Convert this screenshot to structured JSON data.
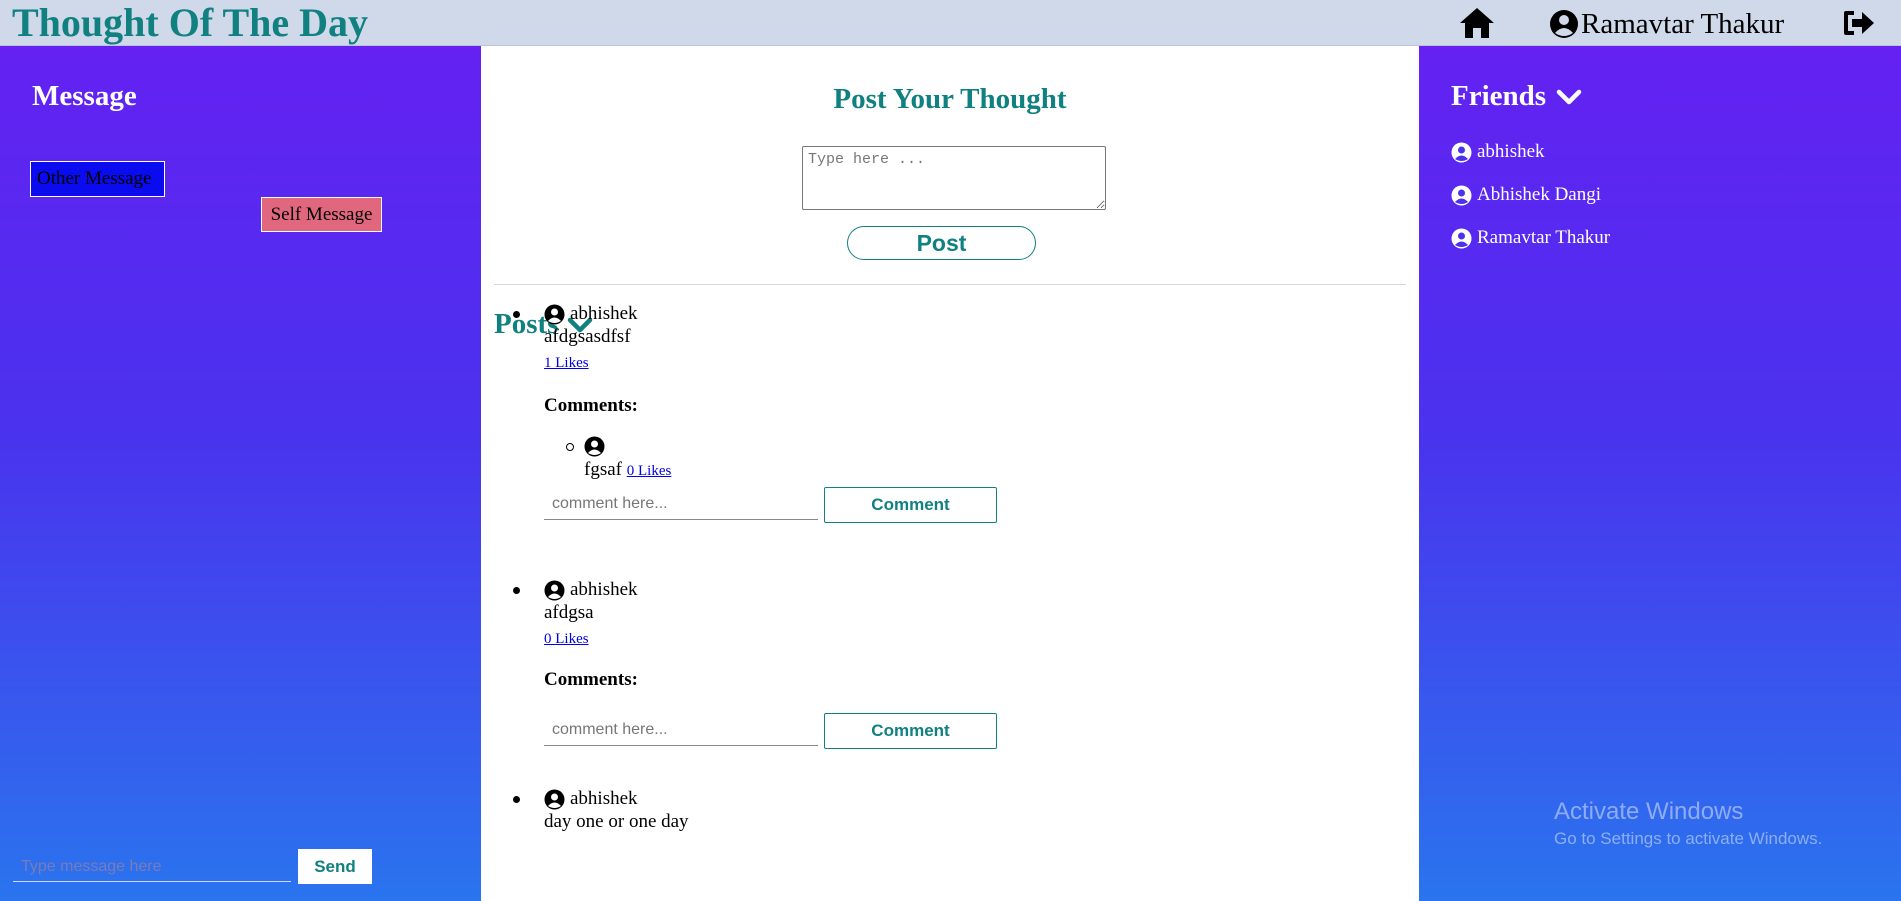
{
  "header": {
    "title": "Thought Of The Day",
    "username": "Ramavtar Thakur",
    "icons": [
      "home-icon",
      "user-circle-icon",
      "logout-icon"
    ]
  },
  "messages": {
    "heading": "Message",
    "other_message": "Other Message",
    "self_message": "Self Message",
    "input_placeholder": "Type message here",
    "send_label": "Send",
    "colors": {
      "other_bg": "#0b0bf0",
      "self_bg": "#e0677e"
    }
  },
  "composer": {
    "heading": "Post Your Thought",
    "textarea_placeholder": "Type here ...",
    "post_label": "Post"
  },
  "posts": {
    "heading": "Posts",
    "comments_label": "Comments:",
    "comment_placeholder": "comment here...",
    "comment_button": "Comment",
    "items": [
      {
        "author": "abhishek",
        "text": "afdgsasdfsf",
        "likes": "1 Likes",
        "comments": [
          {
            "user": "",
            "text": "fgsaf",
            "likes": "0 Likes"
          }
        ]
      },
      {
        "author": "abhishek",
        "text": "afdgsa",
        "likes": "0 Likes",
        "comments": []
      },
      {
        "author": "abhishek",
        "text": "day one or one day"
      }
    ]
  },
  "friends": {
    "heading": "Friends",
    "items": [
      "abhishek",
      "Abhishek Dangi",
      "Ramavtar Thakur"
    ]
  },
  "watermark": {
    "title": "Activate Windows",
    "subtitle": "Go to Settings to activate Windows."
  },
  "theme": {
    "accent": "#118080",
    "topbar_bg": "#cfd9ea",
    "gradient_top": "#6421f2",
    "gradient_bottom": "#2a74ee"
  }
}
